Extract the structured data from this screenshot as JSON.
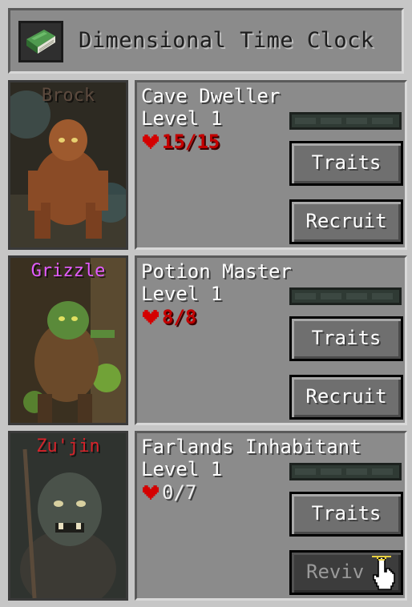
{
  "window": {
    "title": "Dimensional Time Clock",
    "icon": "book-icon"
  },
  "creatures": [
    {
      "pet_name": "Brock",
      "pet_name_color": "#5c4a3e",
      "type": "Cave Dweller",
      "level": "Level 1",
      "health": "15/15",
      "traits_label": "Traits",
      "action_label": "Recruit",
      "action_enabled": true
    },
    {
      "pet_name": "Grizzle",
      "pet_name_color": "#e35bff",
      "type": "Potion Master",
      "level": "Level 1",
      "health": "8/8",
      "traits_label": "Traits",
      "action_label": "Recruit",
      "action_enabled": true
    },
    {
      "pet_name": "Zu'jin",
      "pet_name_color": "#d6232a",
      "type": "Farlands Inhabitant",
      "level": "Level 1",
      "health": "0/7",
      "traits_label": "Traits",
      "action_label": "Reviv",
      "action_enabled": false
    }
  ],
  "colors": {
    "panel": "#8b8b8b",
    "background": "#c6c6c6",
    "health": "#c40000",
    "button": "#6f6f6f"
  }
}
